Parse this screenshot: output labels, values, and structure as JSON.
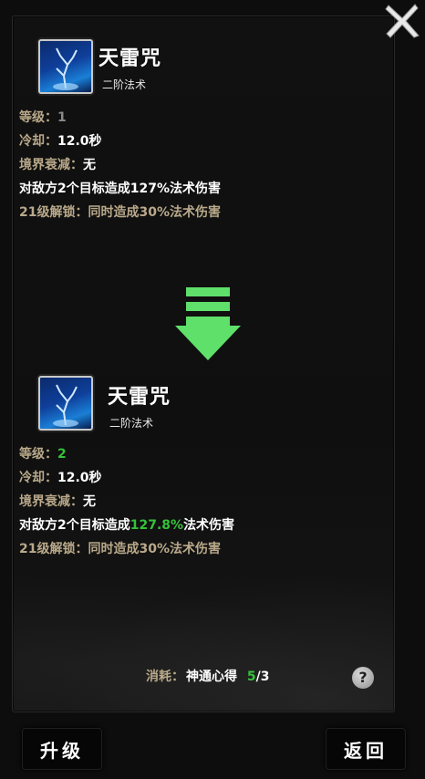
{
  "current": {
    "name": "天雷咒",
    "tier": "二阶法术",
    "level_label": "等级：",
    "level_value": "1",
    "cooldown_label": "冷却：",
    "cooldown_value": "12.0秒",
    "decay_label": "境界衰减：",
    "decay_value": "无",
    "effect_prefix": "对敌方2个目标造成",
    "effect_value": "127%",
    "effect_suffix": "法术伤害",
    "unlock_text": "21级解锁：同时造成30%法术伤害"
  },
  "next": {
    "name": "天雷咒",
    "tier": "二阶法术",
    "level_label": "等级：",
    "level_value": "2",
    "cooldown_label": "冷却：",
    "cooldown_value": "12.0秒",
    "decay_label": "境界衰减：",
    "decay_value": "无",
    "effect_prefix": "对敌方2个目标造成",
    "effect_value": "127.8%",
    "effect_suffix": "法术伤害",
    "unlock_text": "21级解锁：同时造成30%法术伤害"
  },
  "cost": {
    "label": "消耗：",
    "item": "神通心得",
    "have": "5",
    "need": "/3"
  },
  "buttons": {
    "upgrade": "升级",
    "back": "返回",
    "help": "?"
  },
  "icons": {
    "close": "close-x-icon",
    "skill": "thunder-tree-icon",
    "arrow": "upgrade-arrow-icon",
    "help": "question-icon"
  },
  "colors": {
    "label": "#b9a98a",
    "highlight": "#35c23a",
    "arrow": "#5fe06a"
  }
}
